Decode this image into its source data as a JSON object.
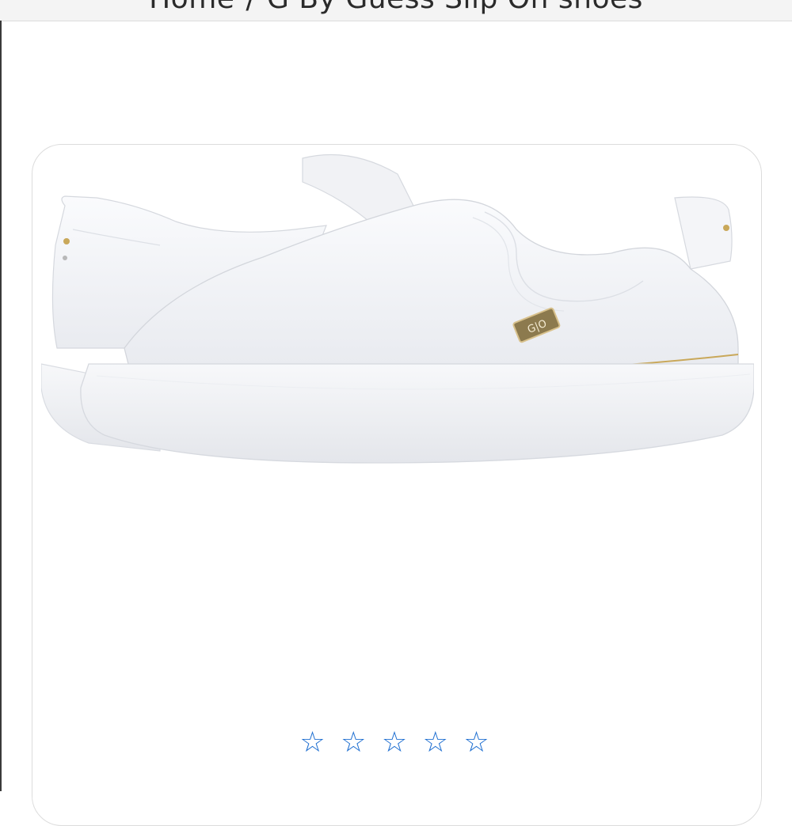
{
  "breadcrumb": {
    "home": "Home",
    "separator": "/",
    "current": "G By Guess Slip On shoes"
  },
  "product": {
    "image_icon": "white-slip-on-sneakers-image",
    "badge_text": "G|O"
  },
  "rating": {
    "value": 0,
    "max": 5,
    "stars": [
      "☆",
      "☆",
      "☆",
      "☆",
      "☆"
    ]
  },
  "colors": {
    "star": "#1f6fd1",
    "card_border": "#dcdcdc",
    "shoe_white": "#f3f4f7",
    "gold": "#c9a85a"
  }
}
